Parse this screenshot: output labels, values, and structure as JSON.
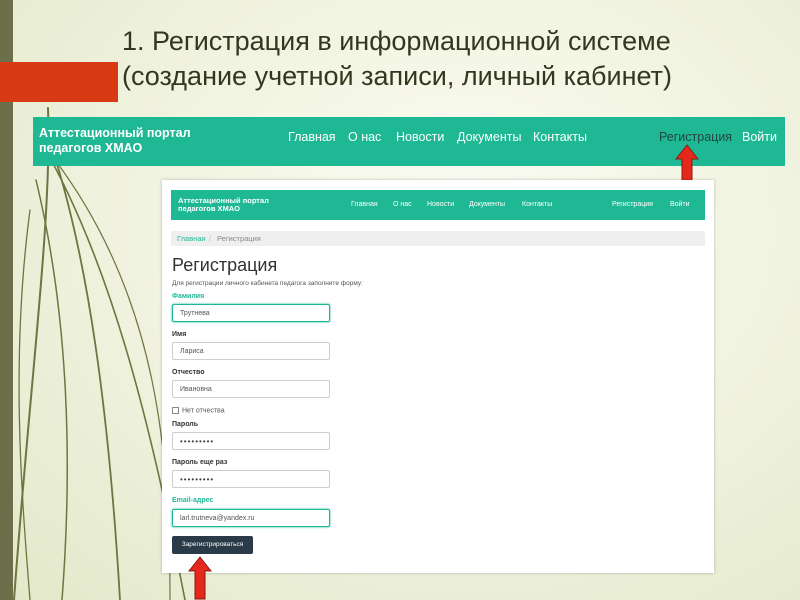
{
  "slide": {
    "title_line1": "1. Регистрация в информационной системе",
    "title_line2": "(создание учетной записи, личный кабинет)",
    "accent_color": "#d83a14"
  },
  "top_nav": {
    "brand_line1": "Аттестационный портал",
    "brand_line2": "педагогов ХМАО",
    "links": [
      "Главная",
      "О нас",
      "Новости",
      "Документы",
      "Контакты"
    ],
    "register": "Регистрация",
    "login": "Войти",
    "color": "#1fb894"
  },
  "screenshot": {
    "nav": {
      "brand_line1": "Аттестационный портал",
      "brand_line2": "педагогов ХМАО",
      "links": [
        "Главная",
        "О нас",
        "Новости",
        "Документы",
        "Контакты"
      ],
      "register": "Регистрация",
      "login": "Войти"
    },
    "breadcrumb": {
      "home": "Главная",
      "separator": "/",
      "current": "Регистрация"
    },
    "page_title": "Регистрация",
    "intro": "Для регистрации личного кабинета педагога заполните форму:",
    "form": {
      "surname_label": "Фамилия",
      "surname_value": "Трутнева",
      "name_label": "Имя",
      "name_value": "Лариса",
      "patronymic_label": "Отчество",
      "patronymic_value": "Ивановна",
      "no_patronymic_label": "Нет отчества",
      "password_label": "Пароль",
      "password_value": "•••••••••",
      "password_repeat_label": "Пароль еще раз",
      "password_repeat_value": "•••••••••",
      "email_label": "Email-адрес",
      "email_value": "larl.trutneva@yandex.ru",
      "submit_label": "Зарегистрироваться"
    }
  },
  "icons": [
    "red-up-arrow-icon",
    "grass-decoration-icon"
  ]
}
